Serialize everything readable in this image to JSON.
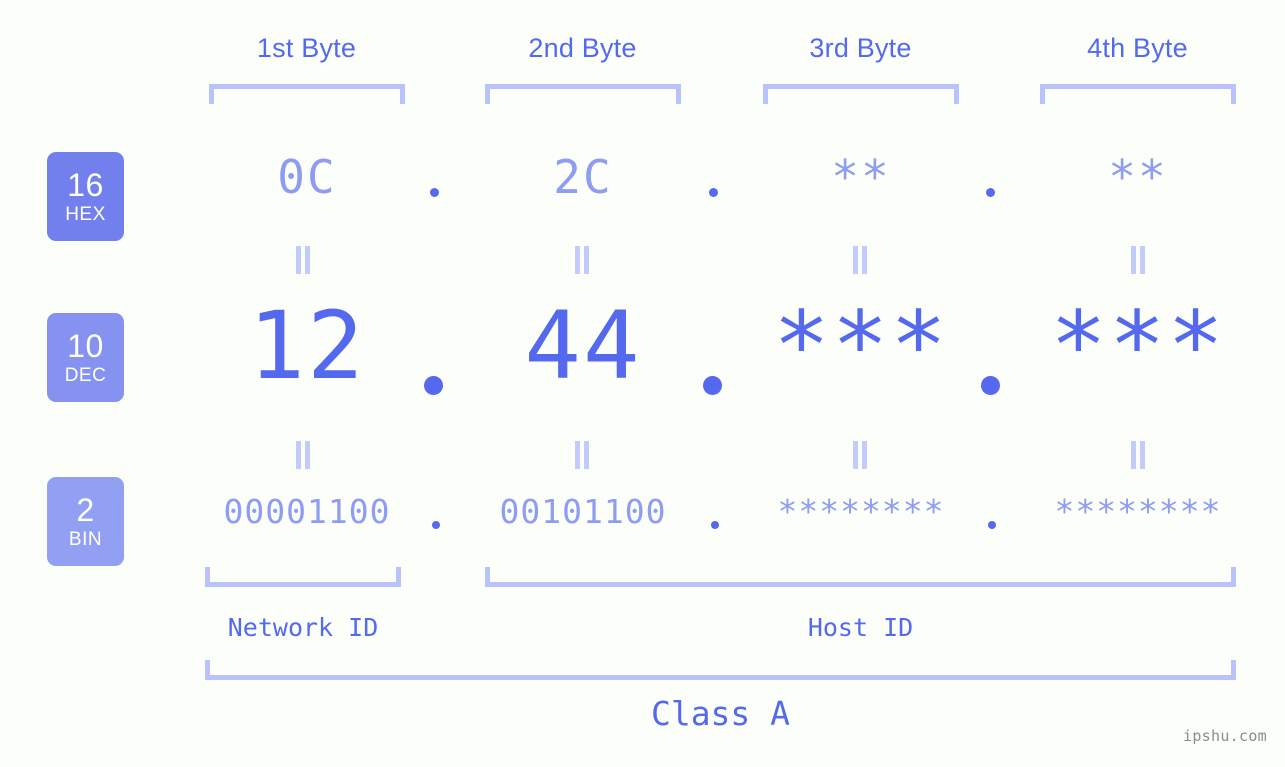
{
  "colors": {
    "background": "#fcfefa",
    "accent_strong": "#5569ee",
    "accent_mid": "#8e9cf2",
    "accent_light": "#b9c2fa",
    "badge_hex": "#7280ee",
    "badge_dec": "#8692f0",
    "badge_bin": "#92a0f3",
    "watermark": "#8c8c8c"
  },
  "byte_headers": [
    {
      "label": "1st Byte"
    },
    {
      "label": "2nd Byte"
    },
    {
      "label": "3rd Byte"
    },
    {
      "label": "4th Byte"
    }
  ],
  "radix_badges": [
    {
      "number": "16",
      "name": "HEX"
    },
    {
      "number": "10",
      "name": "DEC"
    },
    {
      "number": "2",
      "name": "BIN"
    }
  ],
  "rows": {
    "hex": {
      "base": "16",
      "octets": [
        "0C",
        "2C",
        "**",
        "**"
      ],
      "separator": "."
    },
    "dec": {
      "base": "10",
      "octets": [
        "12",
        "44",
        "***",
        "***"
      ],
      "separator": "."
    },
    "bin": {
      "base": "2",
      "octets": [
        "00001100",
        "00101100",
        "********",
        "********"
      ],
      "separator": "."
    }
  },
  "equivalence_symbol": "||",
  "segments": {
    "network_id": "Network ID",
    "host_id": "Host ID",
    "class": "Class A"
  },
  "watermark": "ipshu.com"
}
